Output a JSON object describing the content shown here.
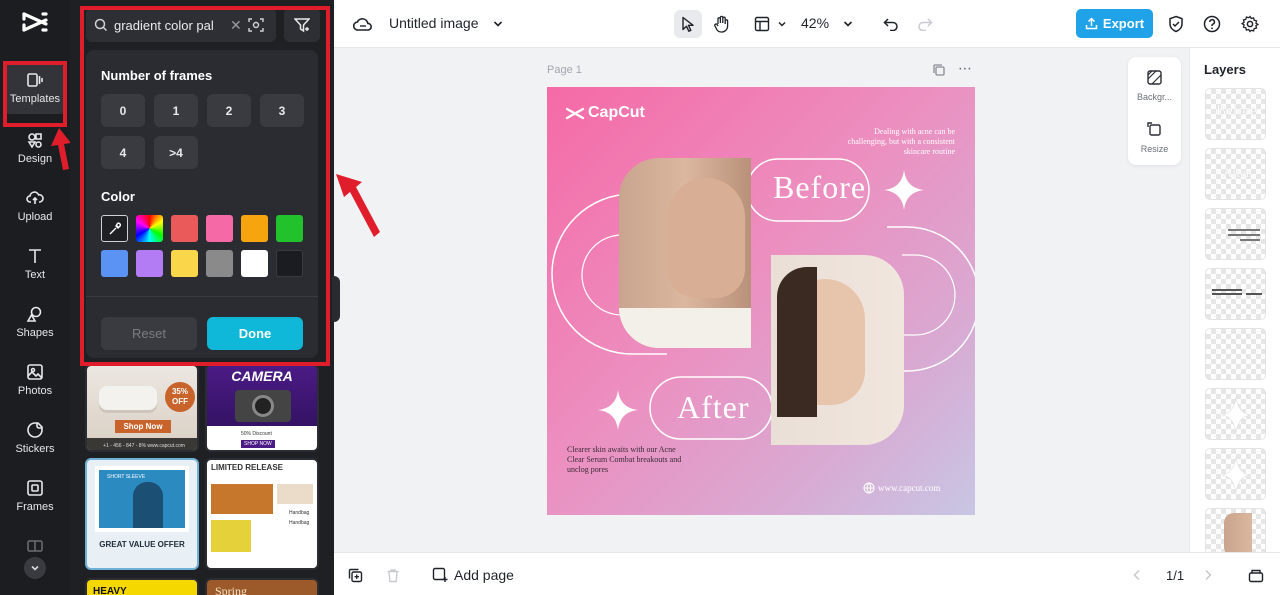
{
  "rail": {
    "items": [
      {
        "label": "Templates"
      },
      {
        "label": "Design"
      },
      {
        "label": "Upload"
      },
      {
        "label": "Text"
      },
      {
        "label": "Shapes"
      },
      {
        "label": "Photos"
      },
      {
        "label": "Stickers"
      },
      {
        "label": "Frames"
      }
    ]
  },
  "panel": {
    "search_value": "gradient color pal",
    "filter": {
      "frames_title": "Number of frames",
      "frames": [
        "0",
        "1",
        "2",
        "3",
        "4",
        ">4"
      ],
      "color_title": "Color",
      "colors": [
        "#ffffff",
        "#rainbow",
        "#ea5a5a",
        "#f56aa6",
        "#f7a50f",
        "#22c22c",
        "#5b93f5",
        "#b37cf5",
        "#fad64b",
        "#8a8a8a",
        "#ffffff",
        "#1b1c22"
      ],
      "reset_label": "Reset",
      "done_label": "Done"
    },
    "templates": [
      {
        "line1": "35%",
        "line2": "OFF",
        "cta": "Shop Now",
        "foot": "+1 - 456 - 847 - 8%  www.capcut.com"
      },
      {
        "title": "CAMERA",
        "sub": "50% Discount",
        "cta": "SHOP NOW"
      },
      {
        "tag": "SHORT SLEEVE",
        "title": "GREAT VALUE OFFER"
      },
      {
        "title": "LIMITED RELEASE",
        "label1": "Handbag",
        "label2": "Handbag"
      },
      {
        "title": "HEAVY"
      },
      {
        "title": "Spring"
      }
    ]
  },
  "topbar": {
    "title": "Untitled image",
    "zoom": "42%",
    "export_label": "Export"
  },
  "canvas": {
    "page_label": "Page 1",
    "brand": "CapCut",
    "intro": [
      "Dealing with acne can be",
      "challenging, but with a consistent",
      "skincare routine"
    ],
    "before": "Before",
    "after": "After",
    "outro": [
      "Clearer skin awaits with our Acne",
      "Clear Serum Combat breakouts and",
      "unclog pores"
    ],
    "url": "www.capcut.com"
  },
  "tools": {
    "background": "Backgr...",
    "resize": "Resize"
  },
  "layers": {
    "title": "Layers",
    "items": [
      "Before",
      "After"
    ]
  },
  "bottombar": {
    "add_page": "Add page",
    "pagination": "1/1"
  },
  "colors": {
    "accent": "#0fb8d8",
    "export": "#1fa2e8",
    "highlight": "#e01e2b"
  }
}
